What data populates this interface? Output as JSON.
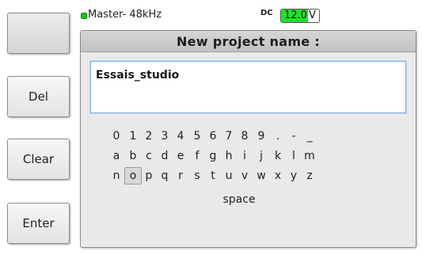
{
  "softkeys": {
    "blank_label": "",
    "del_label": "Del",
    "clear_label": "Clear",
    "enter_label": "Enter"
  },
  "status": {
    "master_text": "Master- 48kHz",
    "dc_label": "DC",
    "dc_value": "12.0",
    "dc_unit": "V",
    "led_color": "#19c21c",
    "dc_highlight_color": "#22e02a"
  },
  "dialog": {
    "title": "New project name :",
    "name_value": "Essais_studio"
  },
  "keyboard": {
    "row1": [
      "0",
      "1",
      "2",
      "3",
      "4",
      "5",
      "6",
      "7",
      "8",
      "9",
      ".",
      "-",
      "_"
    ],
    "row2": [
      "a",
      "b",
      "c",
      "d",
      "e",
      "f",
      "g",
      "h",
      "i",
      "j",
      "k",
      "l",
      "m"
    ],
    "row3": [
      "n",
      "o",
      "p",
      "q",
      "r",
      "s",
      "t",
      "u",
      "v",
      "w",
      "x",
      "y",
      "z"
    ],
    "space_label": "space",
    "selected_key": "o"
  }
}
